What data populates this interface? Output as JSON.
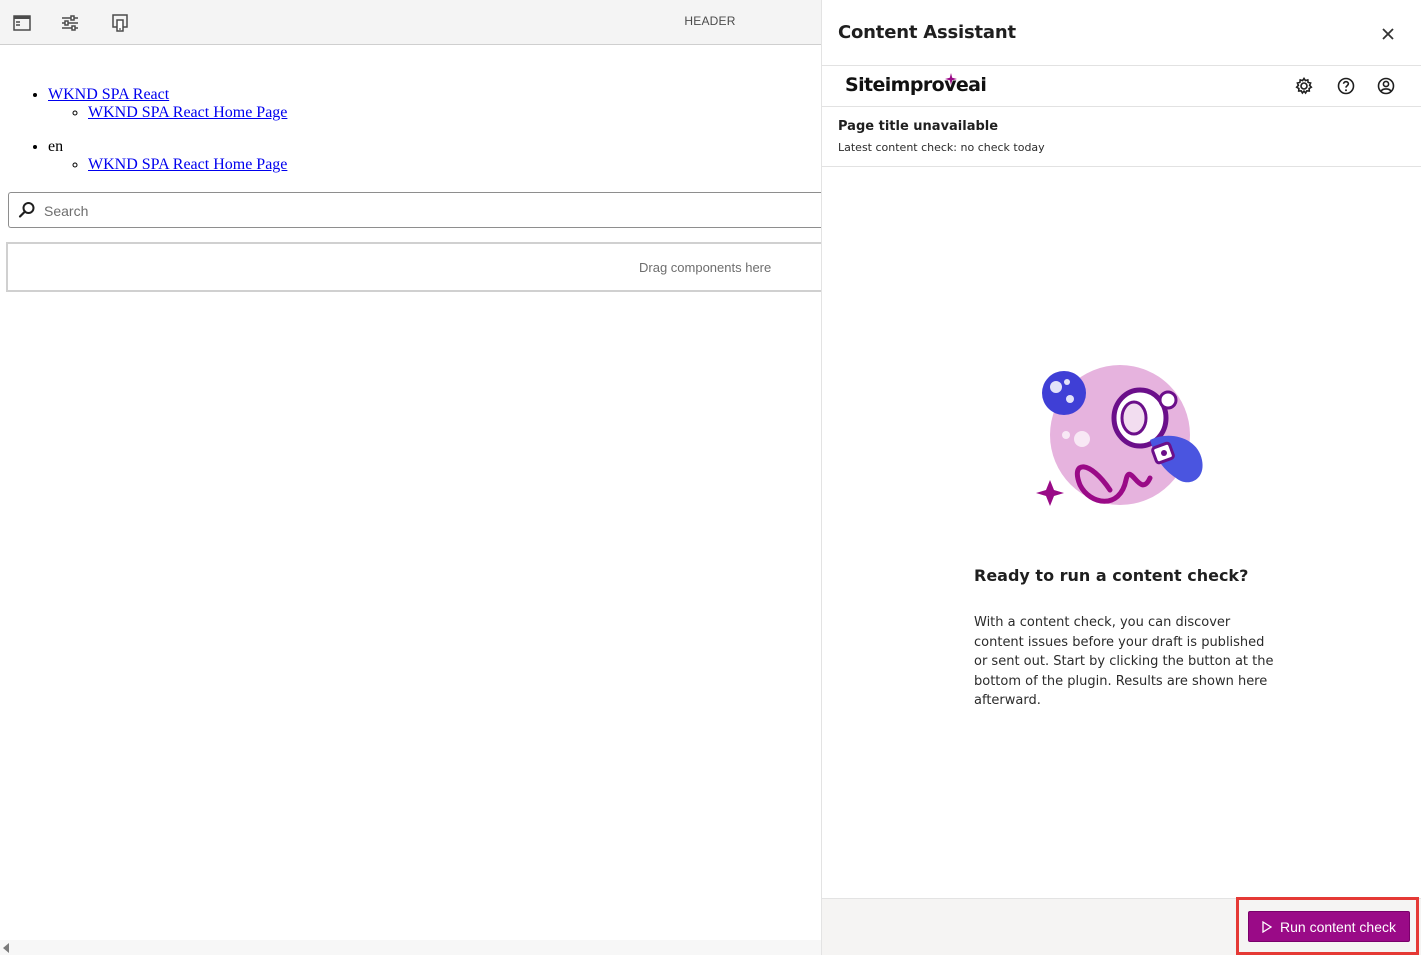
{
  "toolbar": {
    "header_label": "HEADER",
    "icons": [
      "side-panel-icon",
      "properties-sliders-icon",
      "emulator-devices-icon"
    ]
  },
  "nav": {
    "items": [
      {
        "label": "WKND SPA React",
        "link": true,
        "children": [
          "WKND SPA React Home Page"
        ]
      },
      {
        "label": "en",
        "link": false,
        "children": [
          "WKND SPA React Home Page"
        ]
      }
    ]
  },
  "search": {
    "placeholder": "Search",
    "value": ""
  },
  "drop_zone": {
    "label": "Drag components here"
  },
  "panel": {
    "title": "Content Assistant",
    "brand": {
      "name": "Siteimprove",
      "suffix": "ai",
      "accent": "#9a0a87"
    },
    "page_title": "Page title unavailable",
    "check_status": "Latest content check: no check today",
    "ready_heading": "Ready to run a content check?",
    "ready_body": "With a content check, you can discover content issues before your draft is published or sent out. Start by clicking the button at the bottom of the plugin. Results are shown here afterward.",
    "run_button": "Run content check",
    "icons": [
      "close-icon",
      "settings-gear-icon",
      "help-question-icon",
      "account-user-icon",
      "play-icon"
    ]
  },
  "colors": {
    "brand_purple": "#9a0a87",
    "highlight_red": "#e53935"
  }
}
